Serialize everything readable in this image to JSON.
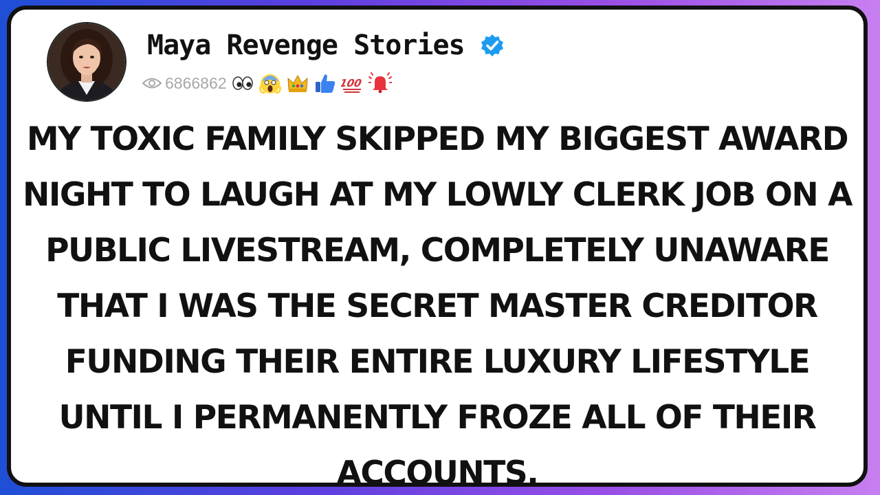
{
  "channel": {
    "name": "Maya Revenge Stories",
    "verified": true,
    "views": "6866862"
  },
  "icons": {
    "verified": "verified-badge-icon",
    "eye": "eye-icon",
    "reactions": [
      "eyes-emoji",
      "screaming-face-emoji",
      "crown-emoji",
      "thumbs-up-emoji",
      "hundred-points-emoji",
      "alarm-bell-emoji"
    ]
  },
  "headline": "MY TOXIC FAMILY SKIPPED MY BIGGEST AWARD NIGHT TO LAUGH AT MY LOWLY CLERK JOB ON A PUBLIC LIVESTREAM, COMPLETELY UNAWARE THAT I WAS THE SECRET MASTER CREDITOR FUNDING THEIR ENTIRE LUXURY LIFESTYLE UNTIL I PERMANENTLY FROZE ALL OF THEIR ACCOUNTS.",
  "colors": {
    "verified_badge": "#1d9bf0",
    "border": "#111111",
    "background_gradient": [
      "#1f4fd6",
      "#5b3fe0",
      "#9b4fe6",
      "#c77ff0"
    ]
  }
}
